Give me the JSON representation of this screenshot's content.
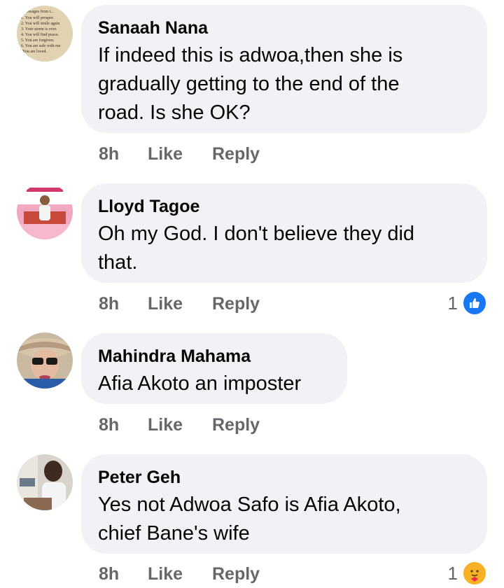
{
  "comments": [
    {
      "name": "Sanaah Nana",
      "lines": [
        "If indeed this is adwoa,then she is",
        "gradually getting to the end of the",
        "road. Is she OK?"
      ],
      "time": "8h",
      "like": "Like",
      "reply": "Reply",
      "reaction_count": "",
      "avatar_text": [
        "essages from t...",
        "1. You will prosper.",
        "2. You will smile again",
        "3. Your storm is over.",
        "4. You will find peace.",
        "5. You are forgiven.",
        "6. You are safe with me",
        "You are loved."
      ]
    },
    {
      "name": "Lloyd Tagoe",
      "lines": [
        "Oh my God. I don't believe they did",
        "that."
      ],
      "time": "8h",
      "like": "Like",
      "reply": "Reply",
      "reaction_count": "1",
      "reaction_icon": "like-reaction-icon"
    },
    {
      "name": "Mahindra Mahama",
      "lines": [
        "Afia Akoto an imposter"
      ],
      "time": "8h",
      "like": "Like",
      "reply": "Reply",
      "reaction_count": ""
    },
    {
      "name": "Peter Geh",
      "lines": [
        "Yes not Adwoa Safo is Afia Akoto,",
        "chief Bane's wife"
      ],
      "time": "8h",
      "like": "Like",
      "reply": "Reply",
      "reaction_count": "1",
      "reaction_icon": "care-reaction-icon"
    }
  ],
  "colors": {
    "bubble": "#f0f2f5",
    "meta": "#65676b",
    "like_blue": "#1877f2",
    "care_yellow": "#f7b125"
  }
}
